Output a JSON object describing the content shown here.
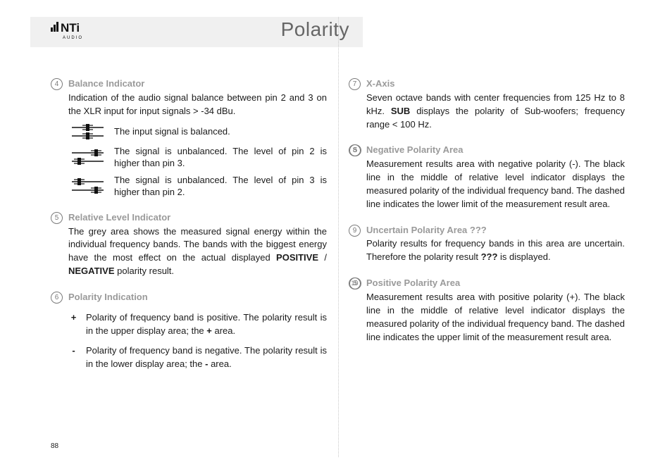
{
  "brand": {
    "name": "NTi",
    "sub": "AUDIO"
  },
  "title": "Polarity",
  "page_number": "88",
  "items": {
    "i4": {
      "num": "4",
      "heading": "Balance Indicator",
      "intro": "Indication of the audio signal balance between pin 2 and 3 on the XLR input for input signals > -34 dBu.",
      "rows": [
        "The input signal is balanced.",
        "The signal is unbalanced. The level of pin 2 is higher than pin 3.",
        "The signal is unbalanced. The level of pin 3 is higher than pin 2."
      ]
    },
    "i5": {
      "num": "5",
      "heading": "Relative Level Indicator",
      "body_a": "The grey area shows the measured signal energy within the individual frequency bands. The bands with the biggest energy have the most effect on the actual displayed ",
      "body_b": "POSITIVE",
      "body_sep": " / ",
      "body_c": "NEGATIVE",
      "body_d": " polarity result."
    },
    "i6": {
      "num": "6",
      "heading": "Polarity Indication",
      "plus_sign": "+",
      "plus_a": "Polarity of frequency band is positive. The polarity result is in the upper display area; the ",
      "plus_b": "+",
      "plus_c": " area.",
      "minus_sign": "-",
      "minus_a": "Polarity of frequency band is negative. The polarity result is in the lower display area; the ",
      "minus_b": "-",
      "minus_c": " area."
    },
    "i7": {
      "num": "7",
      "heading": "X-Axis",
      "body_a": "Seven octave bands with center frequencies from 125 Hz to 8 kHz. ",
      "body_b": "SUB",
      "body_c": " displays the polarity of Sub-woofers; frequency range < 100 Hz."
    },
    "i8": {
      "num": "8",
      "heading": "Negative Polarity Area",
      "body_a": "Measurement results area with negative polarity (-). The black line in the middle of relative level indicator ",
      "ref": "5",
      "body_b": " displays the measured polarity of the individual frequency band. The dashed line indicates the lower limit of the measurement result area."
    },
    "i9": {
      "num": "9",
      "heading": "Uncertain Polarity Area ???",
      "body_a": "Polarity results for frequency bands in this area are uncertain. Therefore the polarity result ",
      "body_b": "???",
      "body_c": " is displayed."
    },
    "i10": {
      "num": "10",
      "heading": "Positive Polarity Area",
      "body_a": "Measurement results area with positive polarity (+). The black line in the middle of relative level indicator ",
      "ref": "5",
      "body_b": " displays the measured polarity of the individual frequency band. The dashed line indicates the upper limit of the measurement result area."
    }
  }
}
